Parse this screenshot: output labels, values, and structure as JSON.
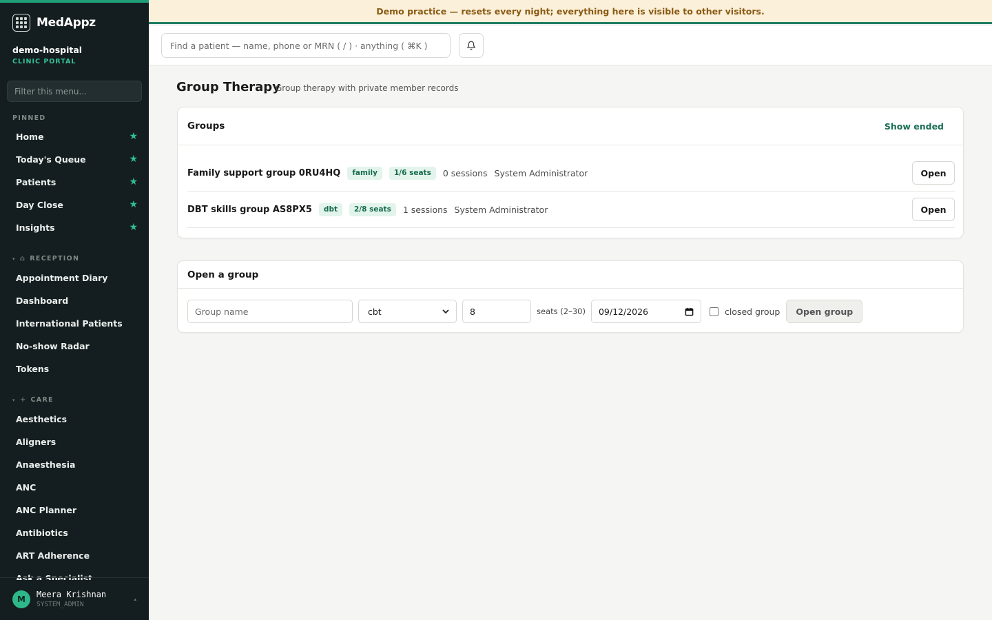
{
  "brand": {
    "name": "MedAppz",
    "logo_icon": "grid-logo-icon"
  },
  "tenant": {
    "name": "demo-hospital",
    "subtitle": "CLINIC PORTAL"
  },
  "sidebar": {
    "filter_placeholder": "Filter this menu...",
    "pinned_label": "PINNED",
    "pinned": [
      {
        "label": "Home"
      },
      {
        "label": "Today's Queue"
      },
      {
        "label": "Patients"
      },
      {
        "label": "Day Close"
      },
      {
        "label": "Insights"
      }
    ],
    "reception_label": "RECEPTION",
    "reception": [
      {
        "label": "Appointment Diary"
      },
      {
        "label": "Dashboard"
      },
      {
        "label": "International Patients"
      },
      {
        "label": "No-show Radar"
      },
      {
        "label": "Tokens"
      }
    ],
    "care_label": "CARE",
    "care": [
      {
        "label": "Aesthetics"
      },
      {
        "label": "Aligners"
      },
      {
        "label": "Anaesthesia"
      },
      {
        "label": "ANC"
      },
      {
        "label": "ANC Planner"
      },
      {
        "label": "Antibiotics"
      },
      {
        "label": "ART Adherence"
      },
      {
        "label": "Ask a Specialist"
      }
    ],
    "star_glyph": "★",
    "accent_color": "#2fbf92"
  },
  "user": {
    "initial": "M",
    "name": "Meera Krishnan",
    "role": "SYSTEM_ADMIN"
  },
  "banner": {
    "text": "Demo practice — resets every night; everything here is visible to other visitors."
  },
  "topbar": {
    "search_placeholder": "Find a patient — name, phone or MRN ( / ) · anything ( ⌘K )"
  },
  "page": {
    "title": "Group Therapy",
    "subtitle": "Group therapy with private member records"
  },
  "groups_card": {
    "title": "Groups",
    "show_ended": "Show ended",
    "rows": [
      {
        "name": "Family support group 0RU4HQ",
        "type": "family",
        "seats": "1/6 seats",
        "sessions": "0 sessions",
        "owner": "System Administrator",
        "action": "Open"
      },
      {
        "name": "DBT skills group AS8PX5",
        "type": "dbt",
        "seats": "2/8 seats",
        "sessions": "1 sessions",
        "owner": "System Administrator",
        "action": "Open"
      }
    ]
  },
  "open_card": {
    "title": "Open a group",
    "name_placeholder": "Group name",
    "type_value": "cbt",
    "seats_value": "8",
    "seats_label": "seats (2–30)",
    "date_value": "09/12/2026",
    "closed_label": "closed group",
    "closed_checked": false,
    "submit_label": "Open group"
  }
}
